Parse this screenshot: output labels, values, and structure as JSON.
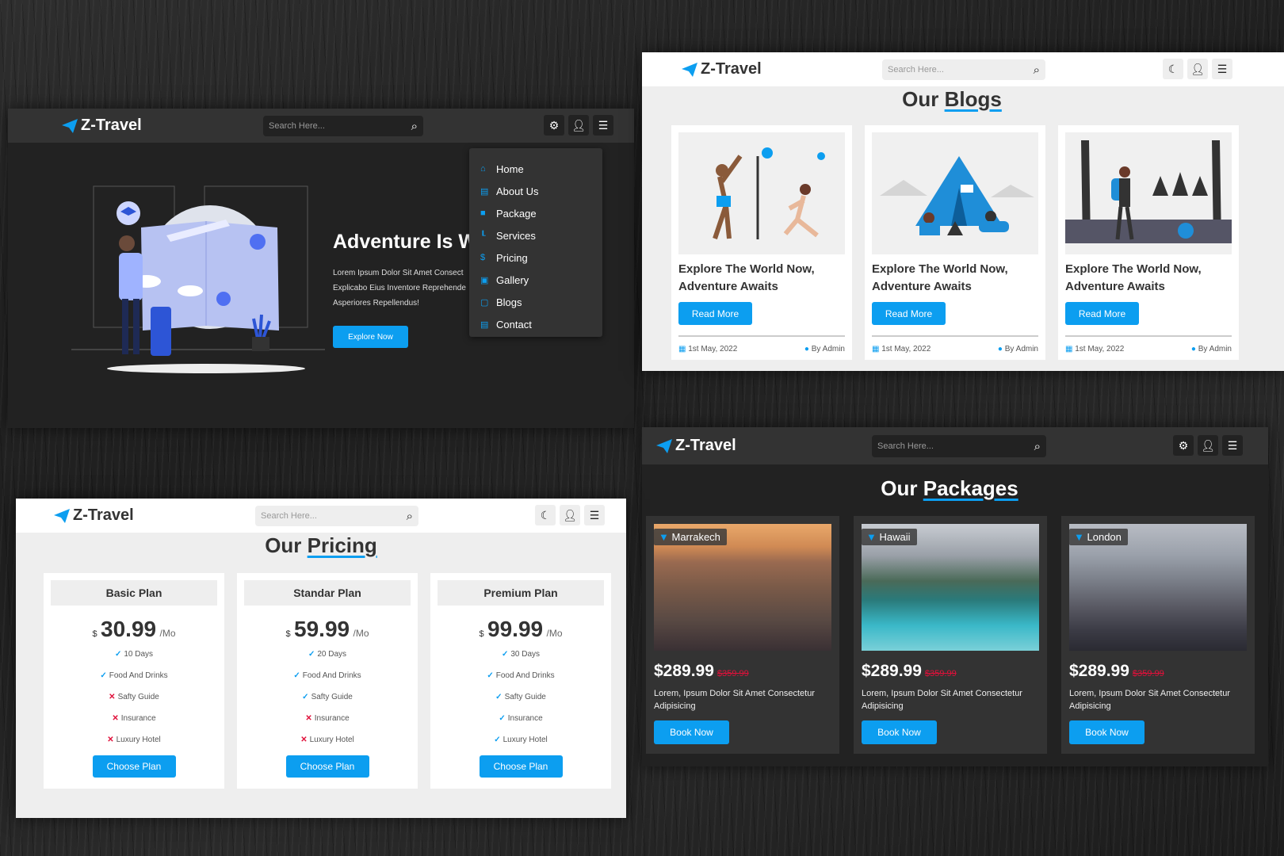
{
  "brand": "Z-Travel",
  "search_placeholder": "Search Here...",
  "hero": {
    "title": "Adventure Is W",
    "desc1": "Lorem Ipsum Dolor Sit Amet Consect",
    "desc2": "Explicabo Eius Inventore Reprehende",
    "desc3": "Asperiores Repellendus!",
    "cta": "Explore Now",
    "menu": [
      {
        "label": "Home",
        "icon": "home-icon"
      },
      {
        "label": "About Us",
        "icon": "id-card-icon"
      },
      {
        "label": "Package",
        "icon": "box-icon"
      },
      {
        "label": "Services",
        "icon": "chart-icon"
      },
      {
        "label": "Pricing",
        "icon": "dollar-icon"
      },
      {
        "label": "Gallery",
        "icon": "image-icon"
      },
      {
        "label": "Blogs",
        "icon": "blog-icon"
      },
      {
        "label": "Contact",
        "icon": "contact-icon"
      }
    ]
  },
  "blogs": {
    "title_a": "Our",
    "title_b": "Blogs",
    "items": [
      {
        "title": "Explore The World Now, Adventure Awaits",
        "cta": "Read More",
        "date": "1st May, 2022",
        "author": "By Admin"
      },
      {
        "title": "Explore The World Now, Adventure Awaits",
        "cta": "Read More",
        "date": "1st May, 2022",
        "author": "By Admin"
      },
      {
        "title": "Explore The World Now, Adventure Awaits",
        "cta": "Read More",
        "date": "1st May, 2022",
        "author": "By Admin"
      }
    ]
  },
  "packages": {
    "title_a": "Our",
    "title_b": "Packages",
    "items": [
      {
        "place": "Marrakech",
        "price": "$289.99",
        "old": "$359.99",
        "desc": "Lorem, Ipsum Dolor Sit Amet Consectetur Adipisicing",
        "cta": "Book Now"
      },
      {
        "place": "Hawaii",
        "price": "$289.99",
        "old": "$359.99",
        "desc": "Lorem, Ipsum Dolor Sit Amet Consectetur Adipisicing",
        "cta": "Book Now"
      },
      {
        "place": "London",
        "price": "$289.99",
        "old": "$359.99",
        "desc": "Lorem, Ipsum Dolor Sit Amet Consectetur Adipisicing",
        "cta": "Book Now"
      }
    ]
  },
  "pricing": {
    "title_a": "Our",
    "title_b": "Pricing",
    "plans": [
      {
        "name": "Basic Plan",
        "currency": "$",
        "amount": "30.99",
        "per": "/Mo",
        "cta": "Choose Plan",
        "features": [
          [
            "✓",
            "10 Days"
          ],
          [
            "✓",
            "Food And Drinks"
          ],
          [
            "✕",
            "Safty Guide"
          ],
          [
            "✕",
            "Insurance"
          ],
          [
            "✕",
            "Luxury Hotel"
          ]
        ]
      },
      {
        "name": "Standar Plan",
        "currency": "$",
        "amount": "59.99",
        "per": "/Mo",
        "cta": "Choose Plan",
        "features": [
          [
            "✓",
            "20 Days"
          ],
          [
            "✓",
            "Food And Drinks"
          ],
          [
            "✓",
            "Safty Guide"
          ],
          [
            "✕",
            "Insurance"
          ],
          [
            "✕",
            "Luxury Hotel"
          ]
        ]
      },
      {
        "name": "Premium Plan",
        "currency": "$",
        "amount": "99.99",
        "per": "/Mo",
        "cta": "Choose Plan",
        "features": [
          [
            "✓",
            "30 Days"
          ],
          [
            "✓",
            "Food And Drinks"
          ],
          [
            "✓",
            "Safty Guide"
          ],
          [
            "✓",
            "Insurance"
          ],
          [
            "✓",
            "Luxury Hotel"
          ]
        ]
      }
    ]
  },
  "colors": {
    "accent": "#0c9ef0",
    "danger": "#e0103a"
  }
}
